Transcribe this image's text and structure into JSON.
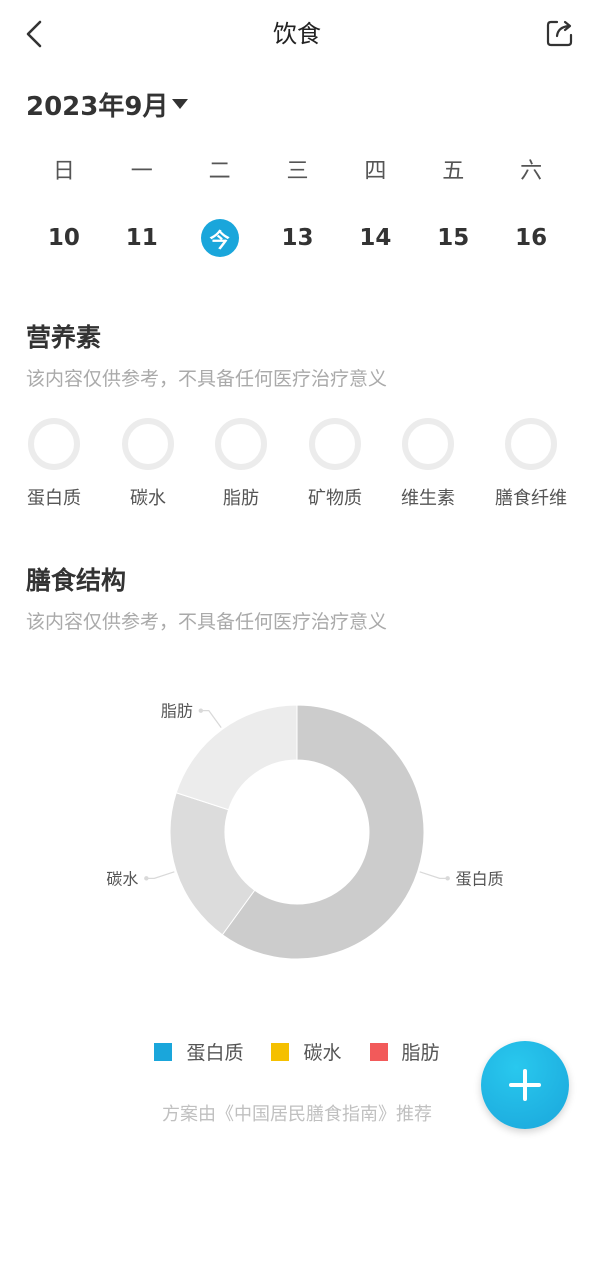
{
  "header": {
    "title": "饮食",
    "back_icon": "chevron-left-icon",
    "share_icon": "share-icon"
  },
  "calendar": {
    "month_label": "2023年9月",
    "weekdays": [
      "日",
      "一",
      "二",
      "三",
      "四",
      "五",
      "六"
    ],
    "dates": [
      "10",
      "11",
      "今",
      "13",
      "14",
      "15",
      "16"
    ],
    "today_index": 2
  },
  "nutrients": {
    "title": "营养素",
    "subtitle": "该内容仅供参考，不具备任何医疗治疗意义",
    "items": [
      "蛋白质",
      "碳水",
      "脂肪",
      "矿物质",
      "维生素",
      "膳食纤维"
    ]
  },
  "diet": {
    "title": "膳食结构",
    "subtitle": "该内容仅供参考，不具备任何医疗治疗意义"
  },
  "chart_data": {
    "type": "pie",
    "categories": [
      "蛋白质",
      "碳水",
      "脂肪"
    ],
    "values": [
      60,
      20,
      20
    ],
    "colors": [
      "#cccccc",
      "#dcdcdc",
      "#ececec"
    ],
    "legend_colors": [
      "#1aa6db",
      "#f5c000",
      "#f25a5a"
    ],
    "legend_placement": "bottom"
  },
  "legend": [
    {
      "label": "蛋白质",
      "color": "#1aa6db"
    },
    {
      "label": "碳水",
      "color": "#f5c000"
    },
    {
      "label": "脂肪",
      "color": "#f25a5a"
    }
  ],
  "footnote": "方案由《中国居民膳食指南》推荐",
  "fab": {
    "icon": "plus-icon",
    "color": "#1aa6db"
  }
}
